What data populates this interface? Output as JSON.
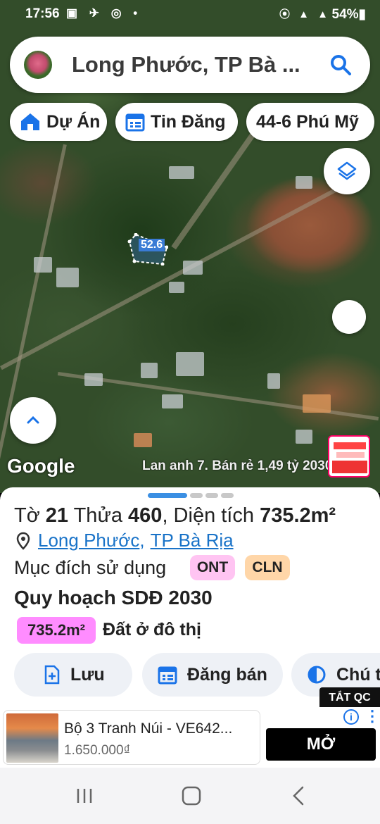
{
  "status_bar": {
    "time": "17:56",
    "left_icons": "▣ ✈ ◎ •",
    "right_icons": "⦿ ▲ ▲",
    "battery": "54%▮"
  },
  "search": {
    "title": "Long Phước, TP Bà ..."
  },
  "chips": [
    {
      "label": "Dự Án",
      "icon": "home-icon"
    },
    {
      "label": "Tin Đăng",
      "icon": "calendar-icon"
    },
    {
      "label": "44-6 Phú Mỹ"
    }
  ],
  "map": {
    "parcel_label": "52.6",
    "google_logo": "Google",
    "ad_overlay_text": "Lan anh 7. Bán rẻ 1,49 tỷ 2030"
  },
  "sheet": {
    "sheet_prefix": "Tờ ",
    "sheet_no": "21",
    "plot_prefix": " Thửa ",
    "plot_no": "460",
    "area_prefix": ", Diện tích ",
    "area": "735.2m²",
    "ward": "Long Phước",
    "separator": ",",
    "city": "TP Bà Rịa",
    "purpose_label": "Mục đích sử dụng",
    "purpose_codes": [
      "ONT",
      "CLN"
    ],
    "plan_title": "Quy hoạch SDĐ 2030",
    "plan_area": "735.2m²",
    "plan_type": "Đất ở đô thị"
  },
  "actions": [
    {
      "label": "Lưu",
      "icon": "save-plus-icon"
    },
    {
      "label": "Đăng bán",
      "icon": "calendar-icon"
    },
    {
      "label": "Chú t",
      "icon": "contrast-icon"
    }
  ],
  "ad": {
    "close_label": "TẮT QC",
    "title": "Bộ 3 Tranh Núi - VE642...",
    "price": "1.650.000₫",
    "cta": "MỞ",
    "info": "i",
    "more": "⋮"
  },
  "colors": {
    "accent": "#1a73c8",
    "badge_ont": "#ffc4f2",
    "badge_cln": "#ffd6a8",
    "plan_badge": "#ff8cff"
  }
}
